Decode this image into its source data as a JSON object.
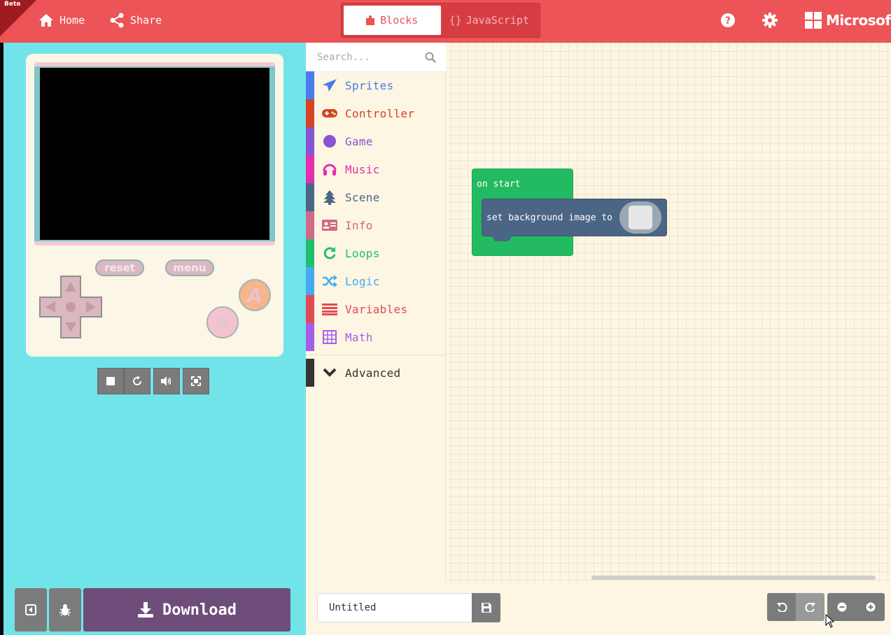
{
  "header": {
    "beta": "Beta",
    "home_label": "Home",
    "share_label": "Share",
    "blocks_label": "Blocks",
    "javascript_label": "JavaScript",
    "javascript_prefix": "{}",
    "brand": "Microsoft"
  },
  "simulator": {
    "reset_label": "reset",
    "menu_label": "menu",
    "a_label": "A",
    "b_label": "B"
  },
  "toolbox": {
    "search_placeholder": "Search...",
    "categories": [
      {
        "label": "Sprites",
        "color": "#4b7bec",
        "icon": "paper-plane-icon"
      },
      {
        "label": "Controller",
        "color": "#d54322",
        "icon": "gamepad-icon"
      },
      {
        "label": "Game",
        "color": "#8854d0",
        "icon": "circle-icon"
      },
      {
        "label": "Music",
        "color": "#e52db0",
        "icon": "headphones-icon"
      },
      {
        "label": "Scene",
        "color": "#4b6584",
        "icon": "tree-icon"
      },
      {
        "label": "Info",
        "color": "#cf6a87",
        "icon": "id-card-icon"
      },
      {
        "label": "Loops",
        "color": "#20bf6b",
        "icon": "refresh-icon"
      },
      {
        "label": "Logic",
        "color": "#45aaf2",
        "icon": "shuffle-icon"
      },
      {
        "label": "Variables",
        "color": "#e14a53",
        "icon": "list-icon"
      },
      {
        "label": "Math",
        "color": "#a55eea",
        "icon": "calculator-icon"
      }
    ],
    "advanced_label": "Advanced"
  },
  "workspace": {
    "on_start_label": "on start",
    "set_bg_label": "set background image to"
  },
  "bottom": {
    "download_label": "Download",
    "project_name": "Untitled"
  },
  "colors": {
    "header": "#ec5458",
    "simulator_bg": "#71e4e9",
    "download": "#6e4d7a",
    "on_start_block": "#22bb61",
    "scene_block": "#4b6584"
  }
}
